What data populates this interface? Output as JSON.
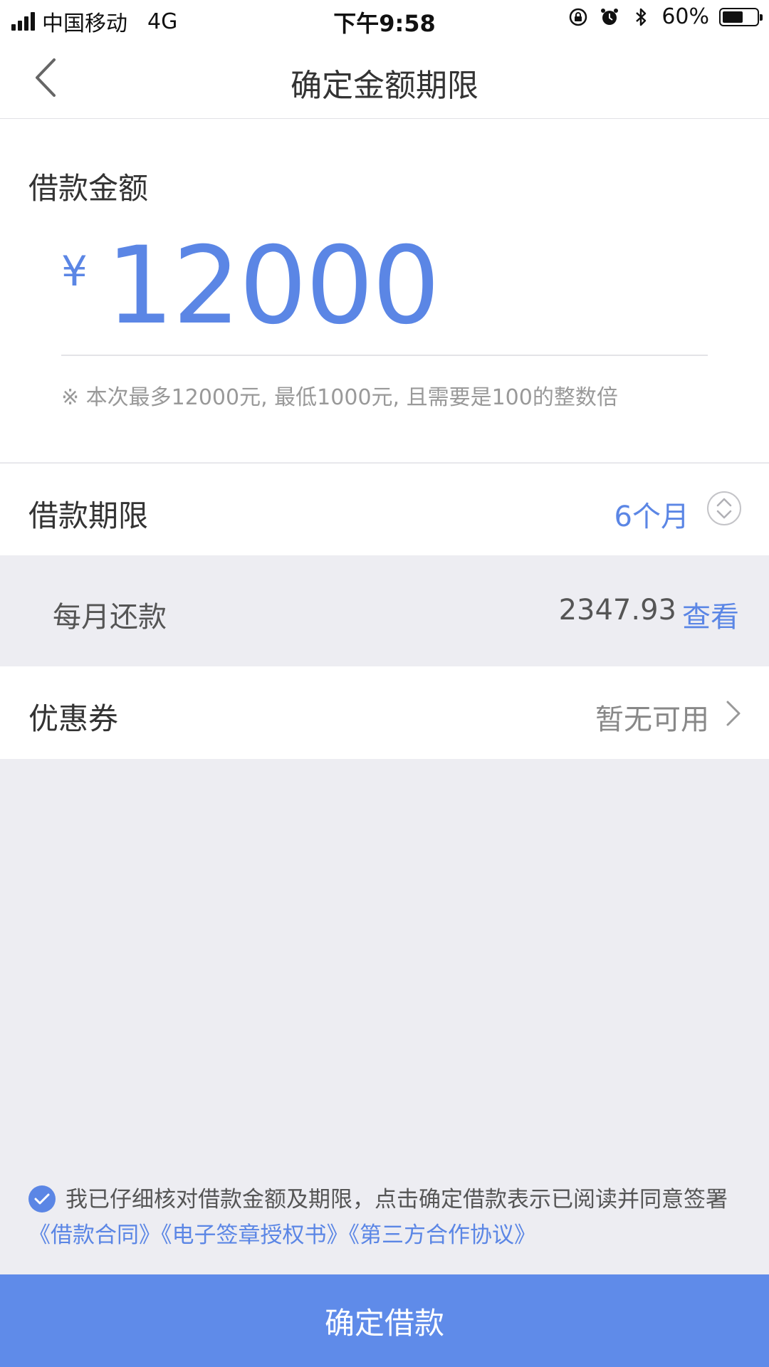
{
  "status_bar": {
    "carrier": "中国移动",
    "network": "4G",
    "time": "下午9:58",
    "battery_percent": "60%",
    "battery_level": 0.6,
    "icons": [
      "signal-icon",
      "orientation-lock-icon",
      "alarm-icon",
      "bluetooth-icon",
      "battery-icon"
    ]
  },
  "nav": {
    "back_icon": "chevron-left-icon",
    "title": "确定金额期限"
  },
  "amount": {
    "label": "借款金额",
    "currency_symbol": "¥",
    "value": "12000",
    "hint": "※ 本次最多12000元, 最低1000元, 且需要是100的整数倍"
  },
  "term": {
    "label": "借款期限",
    "value": "6个月",
    "icon": "up-down-stepper-icon"
  },
  "monthly": {
    "label": "每月还款",
    "amount": "2347.93",
    "link": "查看"
  },
  "coupon": {
    "label": "优惠券",
    "value": "暂无可用",
    "icon": "chevron-right-icon"
  },
  "agreement": {
    "checked": true,
    "text": "我已仔细核对借款金额及期限，点击确定借款表示已阅读并同意签署",
    "links": [
      "《借款合同》",
      "《电子签章授权书》",
      "《第三方合作协议》"
    ]
  },
  "confirm_button": "确定借款",
  "colors": {
    "accent": "#5b86e5",
    "button": "#5f8be9",
    "background": "#ededf2"
  }
}
